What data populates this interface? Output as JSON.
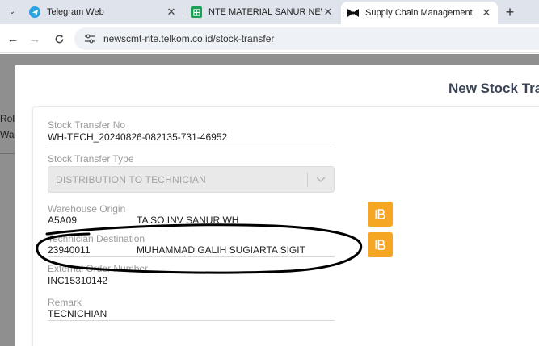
{
  "browser": {
    "tabs": [
      {
        "label": "Telegram Web",
        "icon": "telegram-icon",
        "active": false
      },
      {
        "label": "NTE MATERIAL SANUR NEW - G",
        "icon": "sheets-icon",
        "active": false
      },
      {
        "label": "Supply Chain Management",
        "icon": "bowtie-icon",
        "active": true
      }
    ],
    "url": "newscmt-nte.telkom.co.id/stock-transfer"
  },
  "background": {
    "text_1": "Rol",
    "text_2": "Wa"
  },
  "modal": {
    "title": "New Stock Tra"
  },
  "form": {
    "stock_transfer_no": {
      "label": "Stock Transfer No",
      "value": "WH-TECH_20240826-082135-731-46952"
    },
    "stock_transfer_type": {
      "label": "Stock Transfer Type",
      "value": "DISTRIBUTION TO TECHNICIAN"
    },
    "warehouse_origin": {
      "label": "Warehouse Origin",
      "code": "A5A09",
      "name": "TA SO INV SANUR WH"
    },
    "technician_destination": {
      "label": "Technician Destination",
      "code": "23940011",
      "name": "MUHAMMAD GALIH SUGIARTA SIGIT"
    },
    "external_order_number": {
      "label": "External Order Number",
      "value": "INC15310142"
    },
    "remark": {
      "label": "Remark",
      "value": "TECNICHIAN"
    }
  },
  "colors": {
    "accent_button": "#f5a623",
    "title_text": "#3c4555",
    "overlay": "#8f8f8f"
  }
}
